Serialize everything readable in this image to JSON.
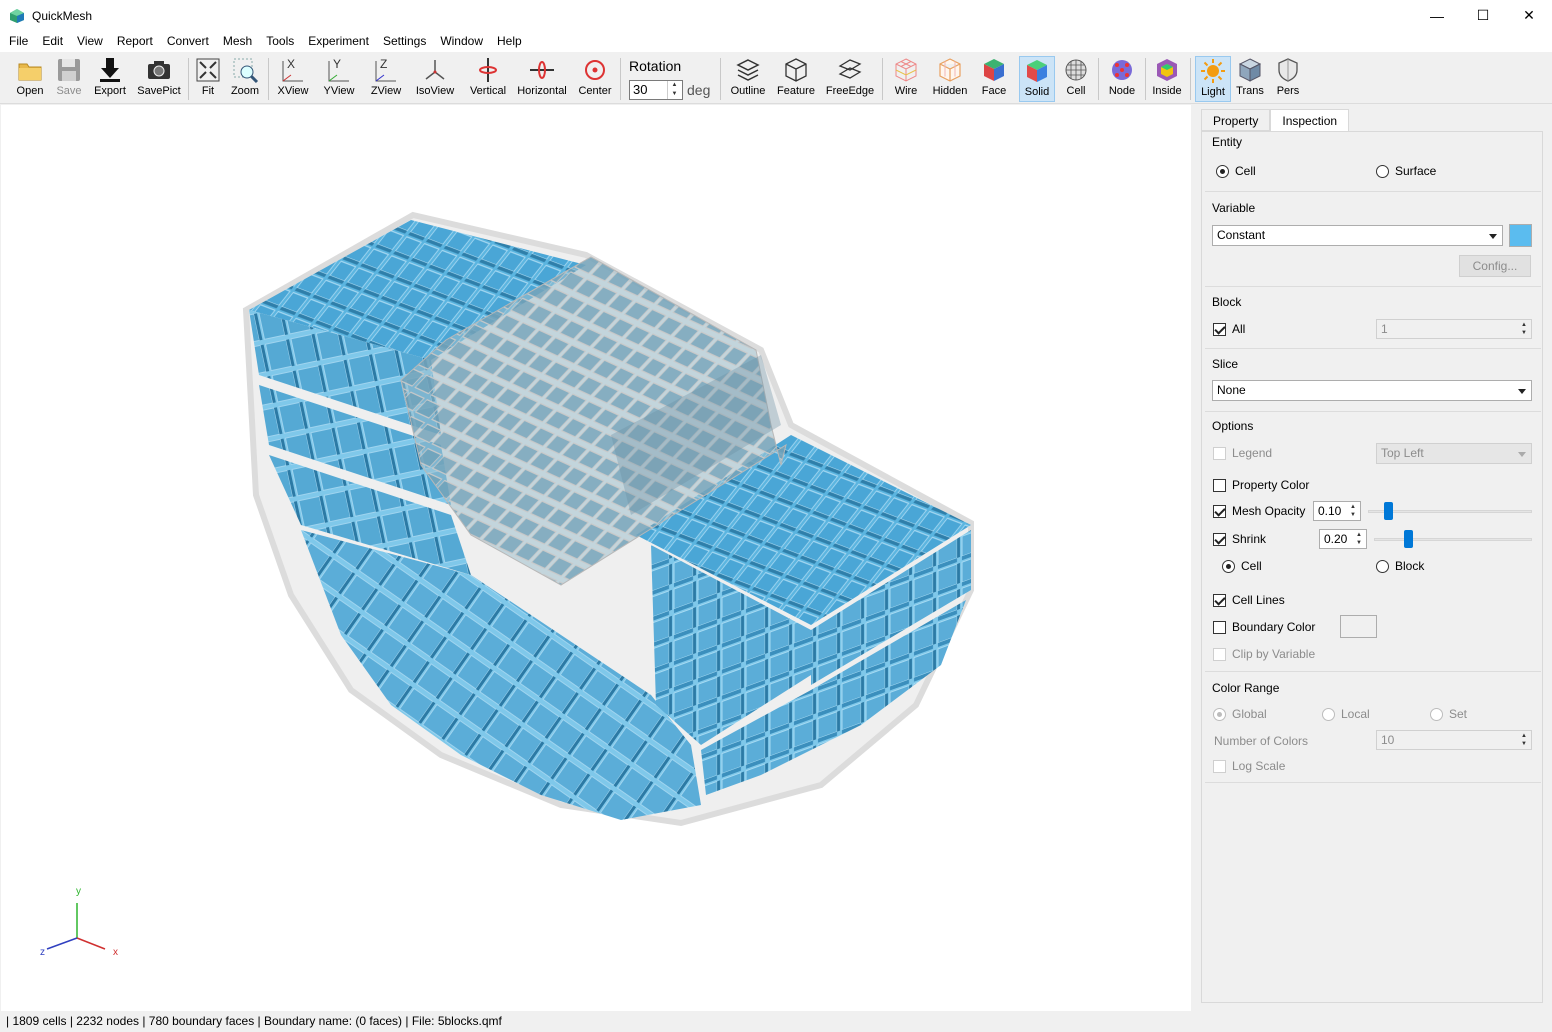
{
  "window": {
    "title": "QuickMesh",
    "minimize": "—",
    "maximize": "☐",
    "close": "✕"
  },
  "menu": [
    "File",
    "Edit",
    "View",
    "Report",
    "Convert",
    "Mesh",
    "Tools",
    "Experiment",
    "Settings",
    "Window",
    "Help"
  ],
  "toolbar": {
    "open": "Open",
    "save": "Save",
    "export": "Export",
    "savepict": "SavePict",
    "fit": "Fit",
    "zoom": "Zoom",
    "xview": "XView",
    "yview": "YView",
    "zview": "ZView",
    "isoview": "IsoView",
    "vertical": "Vertical",
    "horizontal": "Horizontal",
    "center": "Center",
    "rotation_label": "Rotation",
    "rotation_value": "30",
    "rotation_unit": "deg",
    "outline": "Outline",
    "feature": "Feature",
    "freeedge": "FreeEdge",
    "wire": "Wire",
    "hidden": "Hidden",
    "face": "Face",
    "solid": "Solid",
    "cell": "Cell",
    "node": "Node",
    "inside": "Inside",
    "light": "Light",
    "trans": "Trans",
    "pers": "Pers"
  },
  "axes": {
    "y": "y",
    "x": "x",
    "z": "z"
  },
  "panel": {
    "tabs": [
      "Property",
      "Inspection"
    ],
    "entity": {
      "title": "Entity",
      "cell": "Cell",
      "surface": "Surface"
    },
    "variable": {
      "title": "Variable",
      "selected": "Constant",
      "color": "#5bbcef",
      "config": "Config..."
    },
    "block": {
      "title": "Block",
      "all": "All",
      "value": "1"
    },
    "slice": {
      "title": "Slice",
      "selected": "None"
    },
    "options": {
      "title": "Options",
      "legend": "Legend",
      "legend_pos": "Top Left",
      "property_color": "Property Color",
      "mesh_opacity": "Mesh Opacity",
      "mesh_opacity_value": "0.10",
      "mesh_opacity_level": 0.1,
      "shrink": "Shrink",
      "shrink_value": "0.20",
      "shrink_level": 0.2,
      "shrink_cell": "Cell",
      "shrink_block": "Block",
      "cell_lines": "Cell Lines",
      "boundary_color": "Boundary Color",
      "clip_by_variable": "Clip by Variable"
    },
    "color_range": {
      "title": "Color Range",
      "global": "Global",
      "local": "Local",
      "set": "Set",
      "num_colors_label": "Number of Colors",
      "num_colors": "10",
      "log_scale": "Log Scale"
    }
  },
  "status": "| 1809 cells | 2232 nodes | 780 boundary faces |  Boundary name:  (0 faces) | File: 5blocks.qmf",
  "colors": {
    "mesh": "#5bb5e0",
    "mesh_dark": "#3f90bd",
    "accent": "#0078d7"
  }
}
